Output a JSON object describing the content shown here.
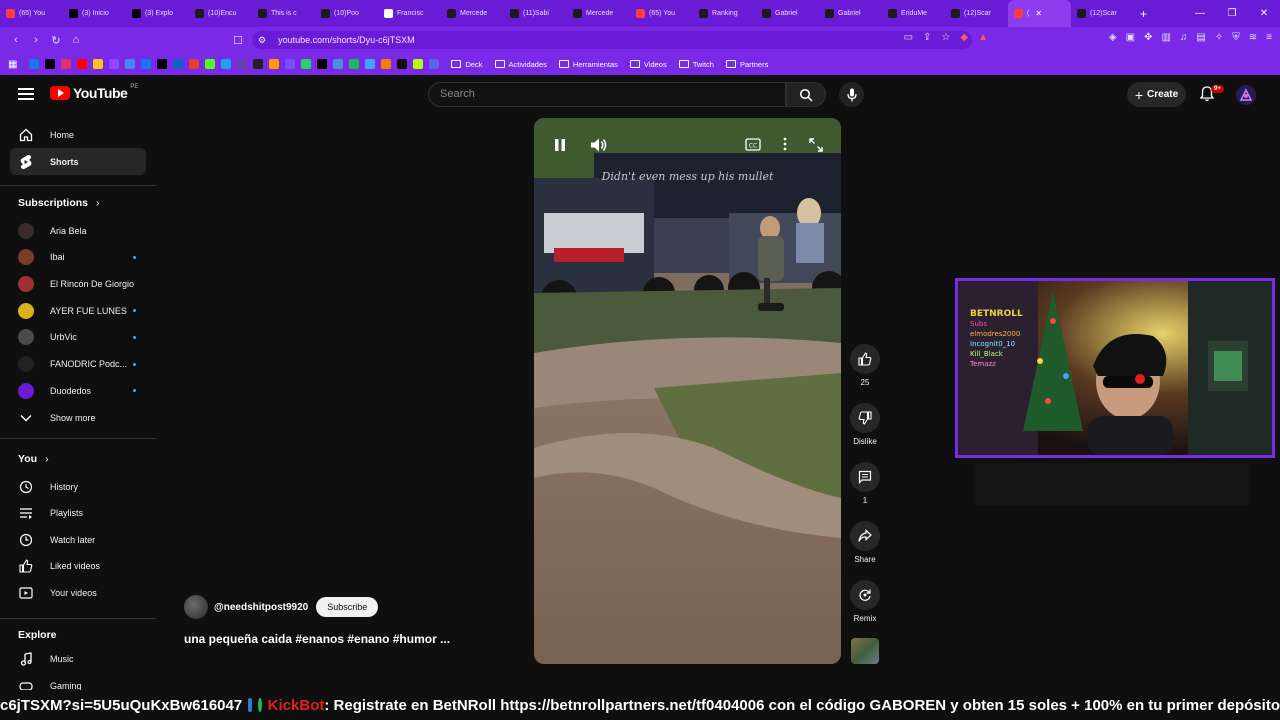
{
  "browser": {
    "tabs": [
      {
        "label": "(65) You",
        "color": "#ff3b3b"
      },
      {
        "label": "(3) Inicio",
        "color": "#000000"
      },
      {
        "label": "(3) Explo",
        "color": "#000000"
      },
      {
        "label": "(10)Encu",
        "color": "#1b1b1b"
      },
      {
        "label": "This is c",
        "color": "#1b1b1b"
      },
      {
        "label": "(10)Poo",
        "color": "#1b1b1b"
      },
      {
        "label": "Francisc",
        "color": "#ffffff"
      },
      {
        "label": "Mercede",
        "color": "#1b1b1b"
      },
      {
        "label": "(11)Sabi",
        "color": "#1b1b1b"
      },
      {
        "label": "Mercede",
        "color": "#1b1b1b"
      },
      {
        "label": "(65) You",
        "color": "#ff3b3b"
      },
      {
        "label": "Ranking",
        "color": "#1b1b1b"
      },
      {
        "label": "Gabriel",
        "color": "#1b1b1b"
      },
      {
        "label": "Gabriel",
        "color": "#1b1b1b"
      },
      {
        "label": "EriduMe",
        "color": "#1b1b1b"
      },
      {
        "label": "(12)Scar",
        "color": "#1b1b1b"
      },
      {
        "label": "(",
        "color": "#ff3b3b",
        "active": true
      },
      {
        "label": "(12)Scar",
        "color": "#1b1b1b"
      }
    ],
    "url": "youtube.com/shorts/Dyu-c6jTSXM",
    "bookmark_folders": [
      "Deck",
      "Actividades",
      "Herramientas",
      "Videos",
      "Twitch",
      "Partners"
    ],
    "bookmark_colors": [
      "#1877f2",
      "#000000",
      "#e1306c",
      "#ff0000",
      "#f5c518",
      "#9146ff",
      "#4285f4",
      "#1877f2",
      "#000000",
      "#0a66c2",
      "#e7402a",
      "#53fc18",
      "#1da1f2",
      "#6441a5",
      "#222222",
      "#ff9900",
      "#7c4dff",
      "#25d366",
      "#000000",
      "#4a90e2",
      "#1db954",
      "#3ea6ff",
      "#ff7a00",
      "#111111",
      "#b5ff00",
      "#5865f2"
    ]
  },
  "youtube": {
    "logo_text": "YouTube",
    "country_code": "PE",
    "search_placeholder": "Search",
    "create_label": "Create",
    "notif_count": "9+"
  },
  "sidebar": {
    "home": "Home",
    "shorts": "Shorts",
    "subscriptions_heading": "Subscriptions",
    "subscriptions": [
      {
        "name": "Aria Bela",
        "color": "#3a2a2a",
        "dot": false
      },
      {
        "name": "Ibai",
        "color": "#7a3b2b",
        "dot": true
      },
      {
        "name": "El Rincón De Giorgio",
        "color": "#a03030",
        "dot": false
      },
      {
        "name": "AYER FUE LUNES",
        "color": "#d8b21f",
        "dot": true
      },
      {
        "name": "UrbVic",
        "color": "#4a4a4a",
        "dot": true
      },
      {
        "name": "FANODRIC Podc...",
        "color": "#222222",
        "dot": true
      },
      {
        "name": "Duodedos",
        "color": "#6a1bd6",
        "dot": true
      }
    ],
    "show_more": "Show more",
    "you_heading": "You",
    "you_items": [
      "History",
      "Playlists",
      "Watch later",
      "Liked videos",
      "Your videos"
    ],
    "explore_heading": "Explore",
    "explore_items": [
      "Music",
      "Gaming"
    ]
  },
  "short": {
    "caption": "Didn't even mess up his mullet",
    "likes": "25",
    "dislike_label": "Dislike",
    "comments": "1",
    "share_label": "Share",
    "remix_label": "Remix",
    "channel": "@needshitpost9920",
    "subscribe_label": "Subscribe",
    "title": "una pequeña caida #enanos #enano #humor ..."
  },
  "stream": {
    "cam_sign_lines": [
      "BETNROLL",
      "Subs",
      "elmodres2000",
      "Incognit0_10",
      "Kill_Black",
      "Temazz"
    ],
    "ticker_prefix": "c6jTSXM?si=5U5uQuKxBw616047",
    "ticker_bot": "KickBot",
    "ticker_message": ": Registrate en BetNRoll https://betnrollpartners.net/tf0404006 con el código GABOREN y obten 15 soles + 100% en tu primer depósito"
  }
}
